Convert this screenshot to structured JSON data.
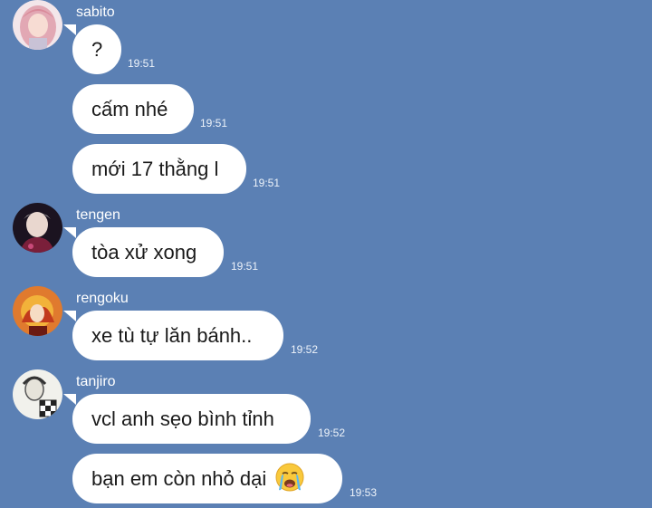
{
  "chat": {
    "groups": [
      {
        "sender": "sabito",
        "avatar_icon": "avatar-pink-hair-icon",
        "messages": [
          {
            "text": "?",
            "time": "19:51"
          },
          {
            "text": "cấm nhé",
            "time": "19:51"
          },
          {
            "text": "mới 17 thằng l",
            "time": "19:51"
          }
        ]
      },
      {
        "sender": "tengen",
        "avatar_icon": "avatar-dark-portrait-icon",
        "messages": [
          {
            "text": "tòa xử xong",
            "time": "19:51"
          }
        ]
      },
      {
        "sender": "rengoku",
        "avatar_icon": "avatar-flame-icon",
        "messages": [
          {
            "text": "xe tù tự lăn bánh..",
            "time": "19:52"
          }
        ]
      },
      {
        "sender": "tanjiro",
        "avatar_icon": "avatar-sketch-icon",
        "messages": [
          {
            "text": "vcl anh sẹo bình tỉnh",
            "time": "19:52"
          },
          {
            "text": "bạn em còn nhỏ dại",
            "time": "19:53",
            "emoji": "crying-face-icon"
          }
        ]
      }
    ]
  },
  "colors": {
    "background": "#5b80b4",
    "bubble": "#ffffff",
    "text": "#1a1a1a",
    "timestamp": "#eef3fa"
  }
}
